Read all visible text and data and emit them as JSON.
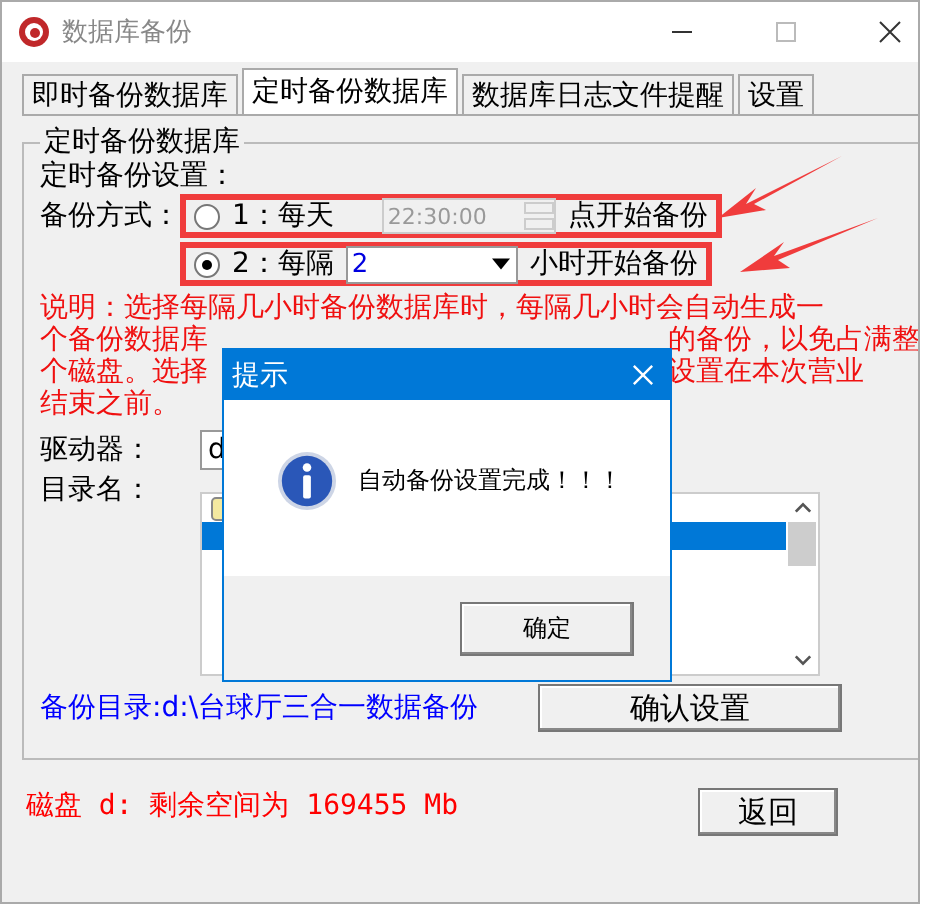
{
  "window": {
    "title": "数据库备份"
  },
  "tabs": [
    {
      "label": "即时备份数据库",
      "selected": false
    },
    {
      "label": "定时备份数据库",
      "selected": true
    },
    {
      "label": "数据库日志文件提醒",
      "selected": false
    },
    {
      "label": "设置",
      "selected": false
    }
  ],
  "group": {
    "title": "定时备份数据库",
    "heading": "定时备份设置：",
    "mode_label": "备份方式：",
    "options": [
      {
        "kind": "time",
        "selected": false,
        "annotated": true,
        "prefix": "1：每天",
        "value": "22:30:00",
        "disabled": true,
        "suffix": "点开始备份"
      },
      {
        "kind": "dropdown",
        "selected": true,
        "annotated": true,
        "prefix": "2：每隔",
        "value": "2",
        "disabled": false,
        "suffix": "小时开始备份"
      }
    ],
    "note_lines": [
      {
        "left": "说明：选择每隔几小时备份数据库时，每隔几小时会自动生成一"
      },
      {
        "left": "个备份数据库",
        "right": "的备份，以免占满整"
      },
      {
        "left": "个磁盘。选择",
        "right": "设置在本次营业"
      },
      {
        "left": "结束之前。"
      }
    ],
    "drive": {
      "label": "驱动器：",
      "value": "d"
    },
    "directory": {
      "label": "目录名：",
      "items": [
        {
          "kind": "folder",
          "selected": false
        },
        {
          "kind": "folder",
          "selected": true
        }
      ]
    },
    "backup_dir": "备份目录:d:\\台球厅三合一数据备份",
    "confirm_button": "确认设置"
  },
  "disk_info": "磁盘 d: 剩余空间为 169455 Mb",
  "return_button": "返回",
  "dialog": {
    "title": "提示",
    "message": "自动备份设置完成！！！",
    "ok_button": "确定"
  }
}
